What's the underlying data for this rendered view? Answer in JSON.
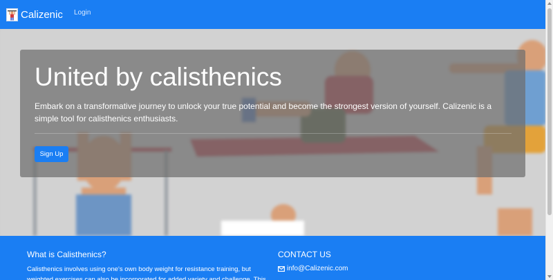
{
  "navbar": {
    "brand": "Calizenic",
    "brand_icon": "calizenic-logo-icon",
    "links": [
      {
        "label": "Login"
      }
    ]
  },
  "hero": {
    "title": "United by calisthenics",
    "text": "Embark on a transformative journey to unlock your true potential and become the strongest version of yourself. Calizenic is a simple tool for calisthenics enthusiasts.",
    "signup_label": "Sign Up"
  },
  "footer": {
    "about_title": "What is Calisthenics?",
    "about_text": "Calisthenics involves using one's own body weight for resistance training, but weighted exercises can also be incorporated for added variety and challenge. This",
    "contact_title": "CONTACT US",
    "email": "info@Calizenic.com",
    "email_icon": "envelope-icon"
  },
  "colors": {
    "primary": "#1a7ef3",
    "hero_overlay": "#6e6e6e",
    "text_light": "#ffffff"
  }
}
